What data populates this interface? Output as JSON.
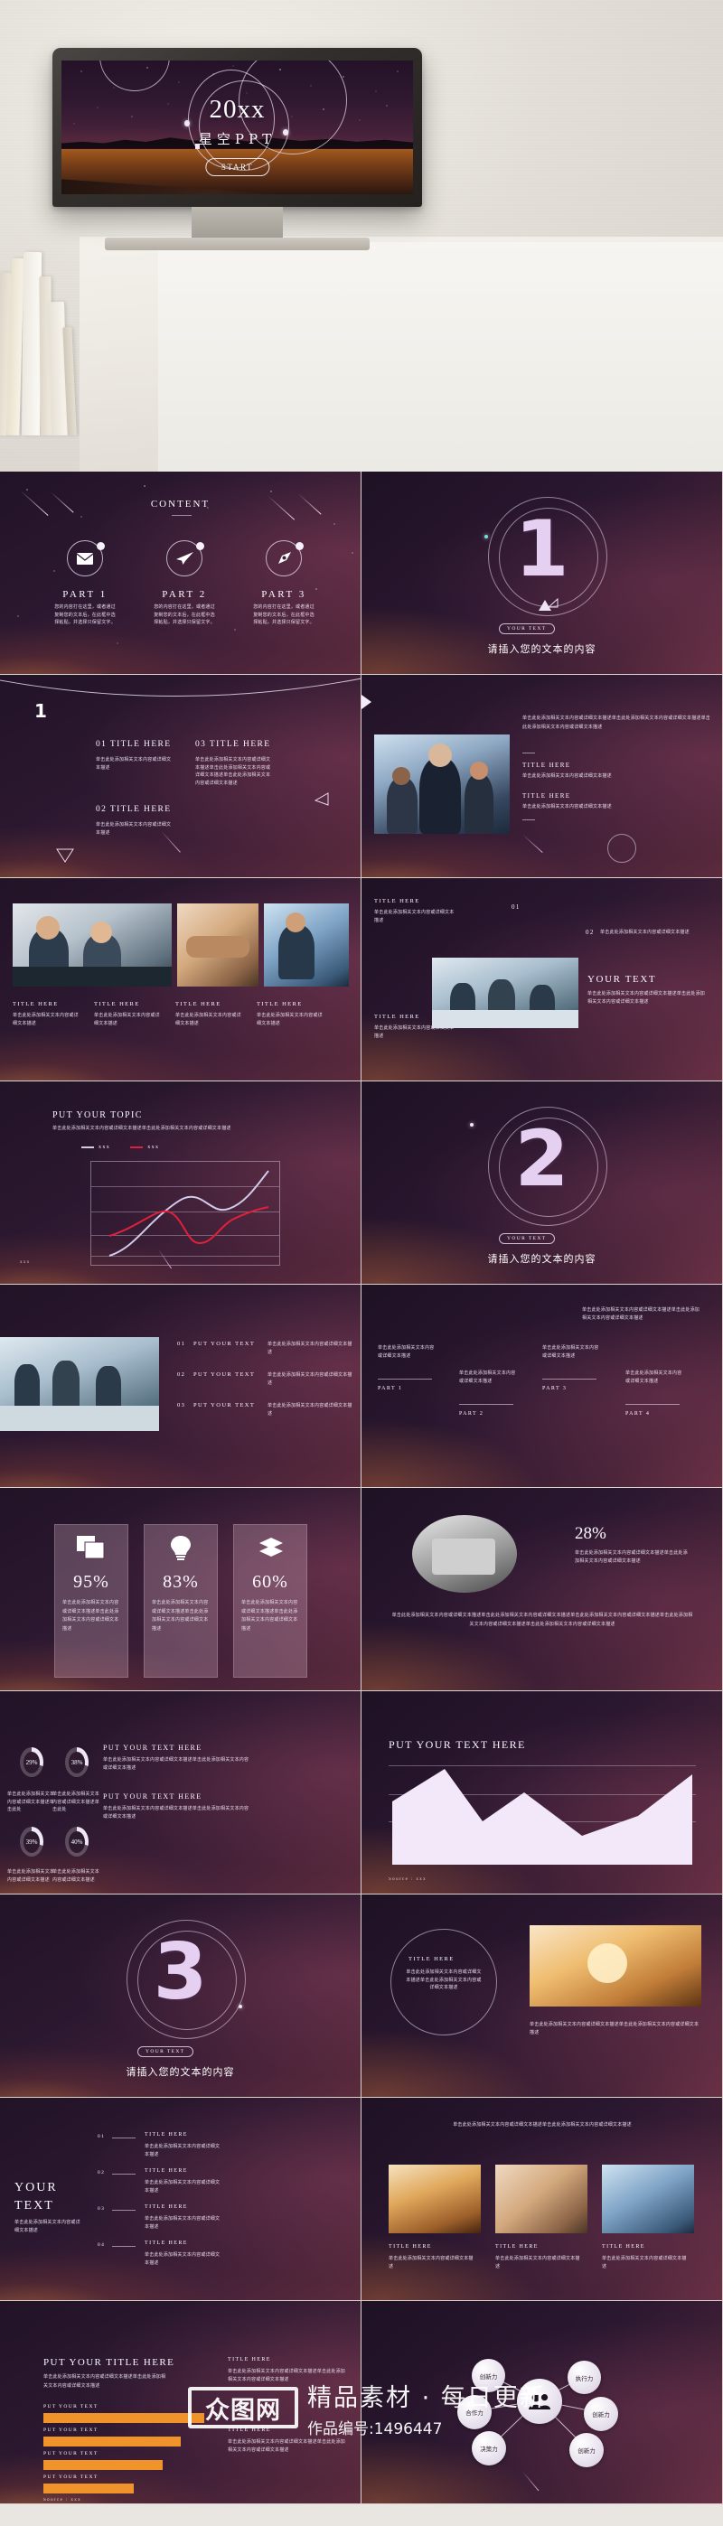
{
  "hero": {
    "title": "20xx",
    "subtitle": "星空PPT",
    "start_label": "START"
  },
  "watermark": {
    "logo_text": "众图网",
    "tagline": "精品素材 · 每日更新",
    "work_id": "作品编号:1496447"
  },
  "common": {
    "body_cn": "单击此处添加相关文本内容或详细文本描述",
    "body_cn_long": "单击此处添加相关文本内容或详细文本描述单击此处添加相关文本内容或详细文本描述单击此处添加相关文本内容或详细文本描述",
    "body_cn_med": "单击此处添加相关文本内容或详细文本描述单击此处添加相关文本内容或详细文本描述",
    "title_here": "TITLE HERE",
    "your_text": "YOUR TEXT",
    "put_your_text": "PUT YOUR TEXT",
    "put_your_text_here": "PUT YOUR TEXT HERE",
    "source": "Source : xxx"
  },
  "slides": [
    {
      "id": "content",
      "heading": "CONTENT",
      "parts": [
        {
          "label": "PART 1",
          "icon": "envelope-icon",
          "desc": "您的内容打在这里，或者通过复制您的文本后，在此框中选择粘贴，并选择只保留文字。"
        },
        {
          "label": "PART 2",
          "icon": "paper-plane-icon",
          "desc": "您的内容打在这里，或者通过复制您的文本后，在此框中选择粘贴，并选择只保留文字。"
        },
        {
          "label": "PART 3",
          "icon": "pen-nib-icon",
          "desc": "您的内容打在这里，或者通过复制您的文本后，在此框中选择粘贴，并选择只保留文字。"
        }
      ]
    },
    {
      "id": "section-1",
      "number": "1",
      "badge": "YOUR TEXT",
      "caption": "请插入您的文本的内容"
    },
    {
      "id": "three-titles",
      "corner_number": "1",
      "items": [
        {
          "title": "01 TITLE HERE",
          "body": "单击此处添加相关文本内容或详细文本描述"
        },
        {
          "title": "02 TITLE HERE",
          "body": "单击此处添加相关文本内容或详细文本描述"
        },
        {
          "title": "03 TITLE HERE",
          "body": "单击此处添加相关文本内容或详细文本描述单击此处添加相关文本内容或详细文本描述单击此处添加相关文本内容或详细文本描述"
        }
      ]
    },
    {
      "id": "photo-text",
      "lead": "单击此处添加相关文本内容或详细文本描述单击此处添加相关文本内容或详细文本描述单击此处添加相关文本内容或详细文本描述",
      "blocks": [
        {
          "title": "TITLE HERE",
          "body": "单击此处添加相关文本内容或详细文本描述"
        },
        {
          "title": "TITLE HERE",
          "body": "单击此处添加相关文本内容或详细文本描述"
        }
      ]
    },
    {
      "id": "four-photos",
      "cards": [
        {
          "title": "TITLE HERE",
          "body": "单击此处添加相关文本内容或详细文本描述"
        },
        {
          "title": "TITLE HERE",
          "body": "单击此处添加相关文本内容或详细文本描述"
        },
        {
          "title": "TITLE HERE",
          "body": "单击此处添加相关文本内容或详细文本描述"
        },
        {
          "title": "TITLE HERE",
          "body": "单击此处添加相关文本内容或详细文本描述"
        }
      ]
    },
    {
      "id": "numbered-photo",
      "top_title": "TITLE HERE",
      "top_body": "单击此处添加相关文本内容或详细文本描述",
      "n01": "01",
      "n02": "02",
      "b02": "单击此处添加相关文本内容或详细文本描述",
      "bottom_title": "TITLE HERE",
      "bottom_body": "单击此处添加相关文本内容或详细文本描述",
      "your_text": "YOUR TEXT",
      "your_text_body": "单击此处添加相关文本内容或详细文本描述单击此处添加相关文本内容或详细文本描述"
    },
    {
      "id": "line-chart",
      "heading": "PUT YOUR TOPIC",
      "subtitle": "单击此处添加相关文本内容或详细文本描述单击此处添加相关文本内容或详细文本描述",
      "legend": [
        "xxx",
        "xxx"
      ],
      "source": "Source : xxx"
    },
    {
      "id": "section-2",
      "number": "2",
      "badge": "YOUR TEXT",
      "caption": "请插入您的文本的内容"
    },
    {
      "id": "list-photo",
      "rows": [
        {
          "num": "01",
          "label": "PUT YOUR TEXT",
          "body": "单击此处添加相关文本内容或详细文本描述"
        },
        {
          "num": "02",
          "label": "PUT YOUR TEXT",
          "body": "单击此处添加相关文本内容或详细文本描述"
        },
        {
          "num": "03",
          "label": "PUT YOUR TEXT",
          "body": "单击此处添加相关文本内容或详细文本描述"
        }
      ]
    },
    {
      "id": "four-parts",
      "parts": [
        {
          "label": "PART 1",
          "body": "单击此处添加相关文本内容或详细文本描述"
        },
        {
          "label": "PART 2",
          "body": "单击此处添加相关文本内容或详细文本描述"
        },
        {
          "label": "PART 3",
          "body": "单击此处添加相关文本内容或详细文本描述"
        },
        {
          "label": "PART 4",
          "body": "单击此处添加相关文本内容或详细文本描述"
        }
      ]
    },
    {
      "id": "percent-cards",
      "cards": [
        {
          "value": "95%",
          "icon": "documents-icon",
          "body": "单击此处添加相关文本内容或详细文本描述单击此处添加相关文本内容或详细文本描述"
        },
        {
          "value": "83%",
          "icon": "lightbulb-icon",
          "body": "单击此处添加相关文本内容或详细文本描述单击此处添加相关文本内容或详细文本描述"
        },
        {
          "value": "60%",
          "icon": "layers-icon",
          "body": "单击此处添加相关文本内容或详细文本描述单击此处添加相关文本内容或详细文本描述"
        }
      ]
    },
    {
      "id": "percent-28",
      "value": "28%",
      "body": "单击此处添加相关文本内容或详细文本描述单击此处添加相关文本内容或详细文本描述",
      "long_body": "单击此处添加相关文本内容或详细文本描述单击此处添加相关文本内容或详细文本描述单击此处添加相关文本内容或详细文本描述单击此处添加相关文本内容或详细文本描述单击此处添加相关文本内容或详细文本描述"
    },
    {
      "id": "donuts",
      "donuts": [
        {
          "value": "29%",
          "body": "单击此处添加相关文本内容或详细文本描述单击此处"
        },
        {
          "value": "38%",
          "body": "单击此处添加相关文本内容或详细文本描述单击此处"
        },
        {
          "value": "39%",
          "body": "单击此处添加相关文本内容或详细文本描述"
        },
        {
          "value": "40%",
          "body": "单击此处添加相关文本内容或详细文本描述"
        }
      ],
      "blocks": [
        {
          "title": "PUT YOUR TEXT HERE",
          "body": "单击此处添加相关文本内容或详细文本描述单击此处添加相关文本内容或详细文本描述"
        },
        {
          "title": "PUT YOUR TEXT HERE",
          "body": "单击此处添加相关文本内容或详细文本描述单击此处添加相关文本内容或详细文本描述"
        }
      ]
    },
    {
      "id": "area-chart",
      "heading": "PUT YOUR TEXT HERE",
      "source": "Source : xxx"
    },
    {
      "id": "section-3",
      "number": "3",
      "badge": "YOUR TEXT",
      "caption": "请插入您的文本的内容"
    },
    {
      "id": "circle-photo",
      "title": "TITLE HERE",
      "body": "单击此处添加相关文本内容或详细文本描述单击此处添加相关文本内容或详细文本描述",
      "bottom_body": "单击此处添加相关文本内容或详细文本描述单击此处添加相关文本内容或详细文本描述"
    },
    {
      "id": "your-text-timeline",
      "heading_l1": "YOUR",
      "heading_l2": "TEXT",
      "heading_body": "单击此处添加相关文本内容或详细文本描述",
      "rows": [
        {
          "num": "01",
          "title": "TITLE HERE",
          "body": "单击此处添加相关文本内容或详细文本描述"
        },
        {
          "num": "02",
          "title": "TITLE HERE",
          "body": "单击此处添加相关文本内容或详细文本描述"
        },
        {
          "num": "03",
          "title": "TITLE HERE",
          "body": "单击此处添加相关文本内容或详细文本描述"
        },
        {
          "num": "04",
          "title": "TITLE HERE",
          "body": "单击此处添加相关文本内容或详细文本描述"
        }
      ]
    },
    {
      "id": "three-photo-cards",
      "lead": "单击此处添加相关文本内容或详细文本描述单击此处添加相关文本内容或详细文本描述",
      "cards": [
        {
          "title": "TITLE HERE",
          "body": "单击此处添加相关文本内容或详细文本描述"
        },
        {
          "title": "TITLE HERE",
          "body": "单击此处添加相关文本内容或详细文本描述"
        },
        {
          "title": "TITLE HERE",
          "body": "单击此处添加相关文本内容或详细文本描述"
        }
      ]
    },
    {
      "id": "bar-chart",
      "heading": "PUT YOUR TITLE HERE",
      "lead": "单击此处添加相关文本内容或详细文本描述单击此处添加相关文本内容或详细文本描述",
      "source": "Source : xxx",
      "side_blocks": [
        {
          "title": "TITLE HERE",
          "body": "单击此处添加相关文本内容或详细文本描述单击此处添加相关文本内容或详细文本描述"
        },
        {
          "title": "TITLE HERE",
          "body": "单击此处添加相关文本内容或详细文本描述单击此处添加相关文本内容或详细文本描述"
        }
      ]
    },
    {
      "id": "network",
      "center_icon": "users-icon",
      "nodes": [
        "创新力",
        "执行力",
        "创新力",
        "合作力",
        "决策力",
        "创新力"
      ]
    }
  ],
  "chart_data": [
    {
      "type": "line",
      "title": "PUT YOUR TOPIC",
      "xlabel": "",
      "ylabel": "",
      "grid": true,
      "legend": [
        "xxx",
        "xxx"
      ],
      "legend_position": "top-left",
      "x": [
        1,
        2,
        3,
        4,
        5,
        6,
        7,
        8
      ],
      "series": [
        {
          "name": "xxx",
          "color": "#cfcbe8",
          "values": [
            8,
            20,
            34,
            58,
            62,
            52,
            60,
            88
          ]
        },
        {
          "name": "xxx",
          "color": "#e0203c",
          "values": [
            22,
            34,
            43,
            32,
            14,
            18,
            44,
            52
          ]
        }
      ],
      "ylim": [
        0,
        100
      ]
    },
    {
      "type": "area",
      "title": "PUT YOUR TEXT HERE",
      "grid": true,
      "x": [
        1,
        2,
        3,
        4,
        5,
        6,
        7
      ],
      "values": [
        62,
        30,
        54,
        22,
        30,
        40,
        78
      ],
      "color": "#f2e8fa",
      "ylim": [
        0,
        100
      ],
      "source": "Source : xxx"
    },
    {
      "type": "bar",
      "title": "PUT YOUR TITLE HERE",
      "orientation": "horizontal",
      "categories": [
        "PUT YOUR TEXT",
        "PUT YOUR TEXT",
        "PUT YOUR TEXT",
        "PUT YOUR TEXT"
      ],
      "values": [
        100,
        86,
        74,
        56
      ],
      "color": "#f0932b",
      "xlim": [
        0,
        100
      ],
      "source": "Source : xxx"
    },
    {
      "type": "pie",
      "title": "donut-indicators",
      "labels": [
        "29%",
        "38%",
        "39%",
        "40%"
      ],
      "values": [
        29,
        38,
        39,
        40
      ]
    },
    {
      "type": "bar",
      "title": "percent-cards",
      "categories": [
        "95%",
        "83%",
        "60%"
      ],
      "values": [
        95,
        83,
        60
      ],
      "color": "#d8b0c4"
    }
  ]
}
